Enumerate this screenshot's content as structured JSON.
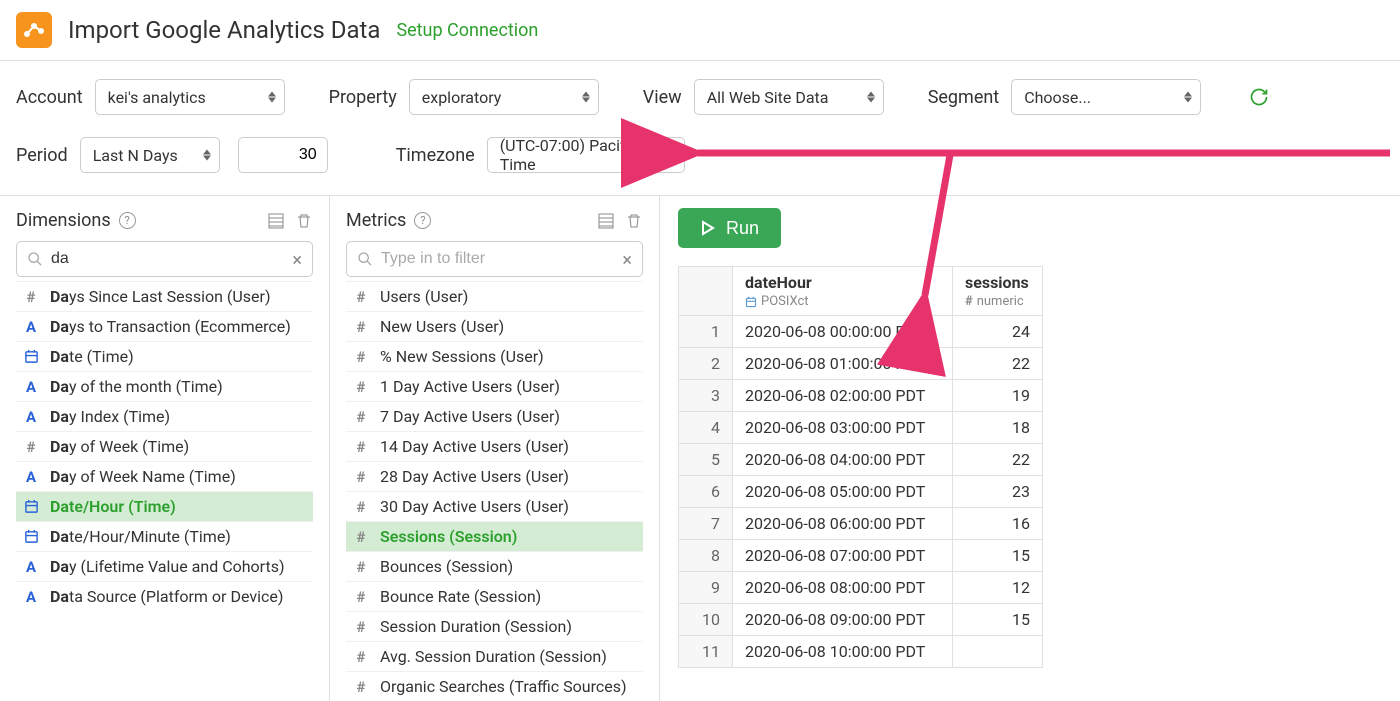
{
  "header": {
    "title": "Import Google Analytics Data",
    "setup": "Setup Connection"
  },
  "filters": {
    "account": {
      "label": "Account",
      "value": "kei's analytics"
    },
    "property": {
      "label": "Property",
      "value": "exploratory"
    },
    "view": {
      "label": "View",
      "value": "All Web Site Data"
    },
    "segment": {
      "label": "Segment",
      "value": "Choose..."
    },
    "period": {
      "label": "Period",
      "value": "Last N Days",
      "n": "30"
    },
    "timezone": {
      "label": "Timezone",
      "value": "(UTC-07:00) Pacific Time"
    }
  },
  "dimensions": {
    "title": "Dimensions",
    "search": "da",
    "items": [
      {
        "icon": "h",
        "pre": "Da",
        "rest": "ys Since Last Session (User)"
      },
      {
        "icon": "a",
        "pre": "Da",
        "rest": "ys to Transaction (Ecommerce)"
      },
      {
        "icon": "d",
        "pre": "Da",
        "rest": "te (Time)"
      },
      {
        "icon": "a",
        "pre": "Da",
        "rest": "y of the month (Time)"
      },
      {
        "icon": "a",
        "pre": "Da",
        "rest": "y Index (Time)"
      },
      {
        "icon": "h",
        "pre": "Da",
        "rest": "y of Week (Time)"
      },
      {
        "icon": "a",
        "pre": "Da",
        "rest": "y of Week Name (Time)"
      },
      {
        "icon": "d",
        "pre": "Da",
        "rest": "te/Hour (Time)",
        "selected": true
      },
      {
        "icon": "d",
        "pre": "Da",
        "rest": "te/Hour/Minute (Time)"
      },
      {
        "icon": "a",
        "pre": "Da",
        "rest": "y (Lifetime Value and Cohorts)"
      },
      {
        "icon": "a",
        "pre": "Da",
        "rest": "ta Source (Platform or Device)"
      }
    ]
  },
  "metrics": {
    "title": "Metrics",
    "placeholder": "Type in to filter",
    "items": [
      {
        "icon": "h",
        "label": "Users (User)"
      },
      {
        "icon": "h",
        "label": "New Users (User)"
      },
      {
        "icon": "h",
        "label": "% New Sessions (User)"
      },
      {
        "icon": "h",
        "label": "1 Day Active Users (User)"
      },
      {
        "icon": "h",
        "label": "7 Day Active Users (User)"
      },
      {
        "icon": "h",
        "label": "14 Day Active Users (User)"
      },
      {
        "icon": "h",
        "label": "28 Day Active Users (User)"
      },
      {
        "icon": "h",
        "label": "30 Day Active Users (User)"
      },
      {
        "icon": "h",
        "label": "Sessions (Session)",
        "selected": true
      },
      {
        "icon": "h",
        "label": "Bounces (Session)"
      },
      {
        "icon": "h",
        "label": "Bounce Rate (Session)"
      },
      {
        "icon": "h",
        "label": "Session Duration (Session)"
      },
      {
        "icon": "h",
        "label": "Avg. Session Duration (Session)"
      },
      {
        "icon": "h",
        "label": "Organic Searches (Traffic Sources)"
      }
    ]
  },
  "run": "Run",
  "table": {
    "cols": [
      {
        "name": "dateHour",
        "type": "POSIXct",
        "type_icon": "d"
      },
      {
        "name": "sessions",
        "type": "numeric",
        "type_icon": "h"
      }
    ],
    "rows": [
      {
        "n": "1",
        "dateHour": "2020-06-08 00:00:00 PDT",
        "sessions": "24"
      },
      {
        "n": "2",
        "dateHour": "2020-06-08 01:00:00 PDT",
        "sessions": "22"
      },
      {
        "n": "3",
        "dateHour": "2020-06-08 02:00:00 PDT",
        "sessions": "19"
      },
      {
        "n": "4",
        "dateHour": "2020-06-08 03:00:00 PDT",
        "sessions": "18"
      },
      {
        "n": "5",
        "dateHour": "2020-06-08 04:00:00 PDT",
        "sessions": "22"
      },
      {
        "n": "6",
        "dateHour": "2020-06-08 05:00:00 PDT",
        "sessions": "23"
      },
      {
        "n": "7",
        "dateHour": "2020-06-08 06:00:00 PDT",
        "sessions": "16"
      },
      {
        "n": "8",
        "dateHour": "2020-06-08 07:00:00 PDT",
        "sessions": "15"
      },
      {
        "n": "9",
        "dateHour": "2020-06-08 08:00:00 PDT",
        "sessions": "12"
      },
      {
        "n": "10",
        "dateHour": "2020-06-08 09:00:00 PDT",
        "sessions": "15"
      },
      {
        "n": "11",
        "dateHour": "2020-06-08 10:00:00 PDT",
        "sessions": ""
      }
    ]
  }
}
